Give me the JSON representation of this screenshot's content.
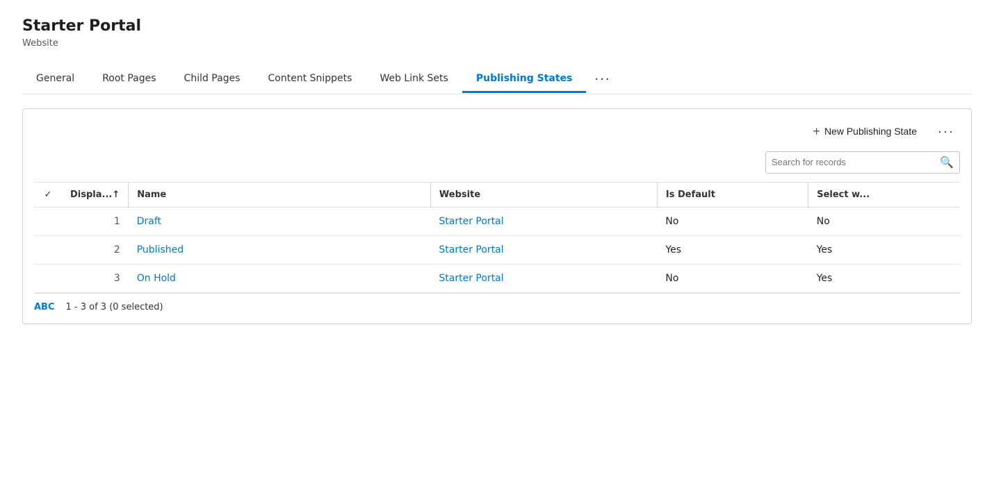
{
  "header": {
    "title": "Starter Portal",
    "subtitle": "Website"
  },
  "tabs": [
    {
      "id": "general",
      "label": "General",
      "active": false
    },
    {
      "id": "root-pages",
      "label": "Root Pages",
      "active": false
    },
    {
      "id": "child-pages",
      "label": "Child Pages",
      "active": false
    },
    {
      "id": "content-snippets",
      "label": "Content Snippets",
      "active": false
    },
    {
      "id": "web-link-sets",
      "label": "Web Link Sets",
      "active": false
    },
    {
      "id": "publishing-states",
      "label": "Publishing States",
      "active": true
    }
  ],
  "more_label": "···",
  "toolbar": {
    "new_button_label": "New Publishing State",
    "new_button_plus": "+",
    "more_label": "···"
  },
  "search": {
    "placeholder": "Search for records"
  },
  "table": {
    "columns": [
      {
        "id": "check",
        "label": "✓",
        "type": "check"
      },
      {
        "id": "display",
        "label": "Displa...↑",
        "sortable": true
      },
      {
        "id": "name",
        "label": "Name"
      },
      {
        "id": "website",
        "label": "Website"
      },
      {
        "id": "is_default",
        "label": "Is Default"
      },
      {
        "id": "select_w",
        "label": "Select w..."
      }
    ],
    "rows": [
      {
        "num": "1",
        "name": "Draft",
        "website": "Starter Portal",
        "is_default": "No",
        "select_w": "No"
      },
      {
        "num": "2",
        "name": "Published",
        "website": "Starter Portal",
        "is_default": "Yes",
        "select_w": "Yes"
      },
      {
        "num": "3",
        "name": "On Hold",
        "website": "Starter Portal",
        "is_default": "No",
        "select_w": "Yes"
      }
    ]
  },
  "footer": {
    "abc_label": "ABC",
    "count_label": "1 - 3 of 3 (0 selected)"
  }
}
